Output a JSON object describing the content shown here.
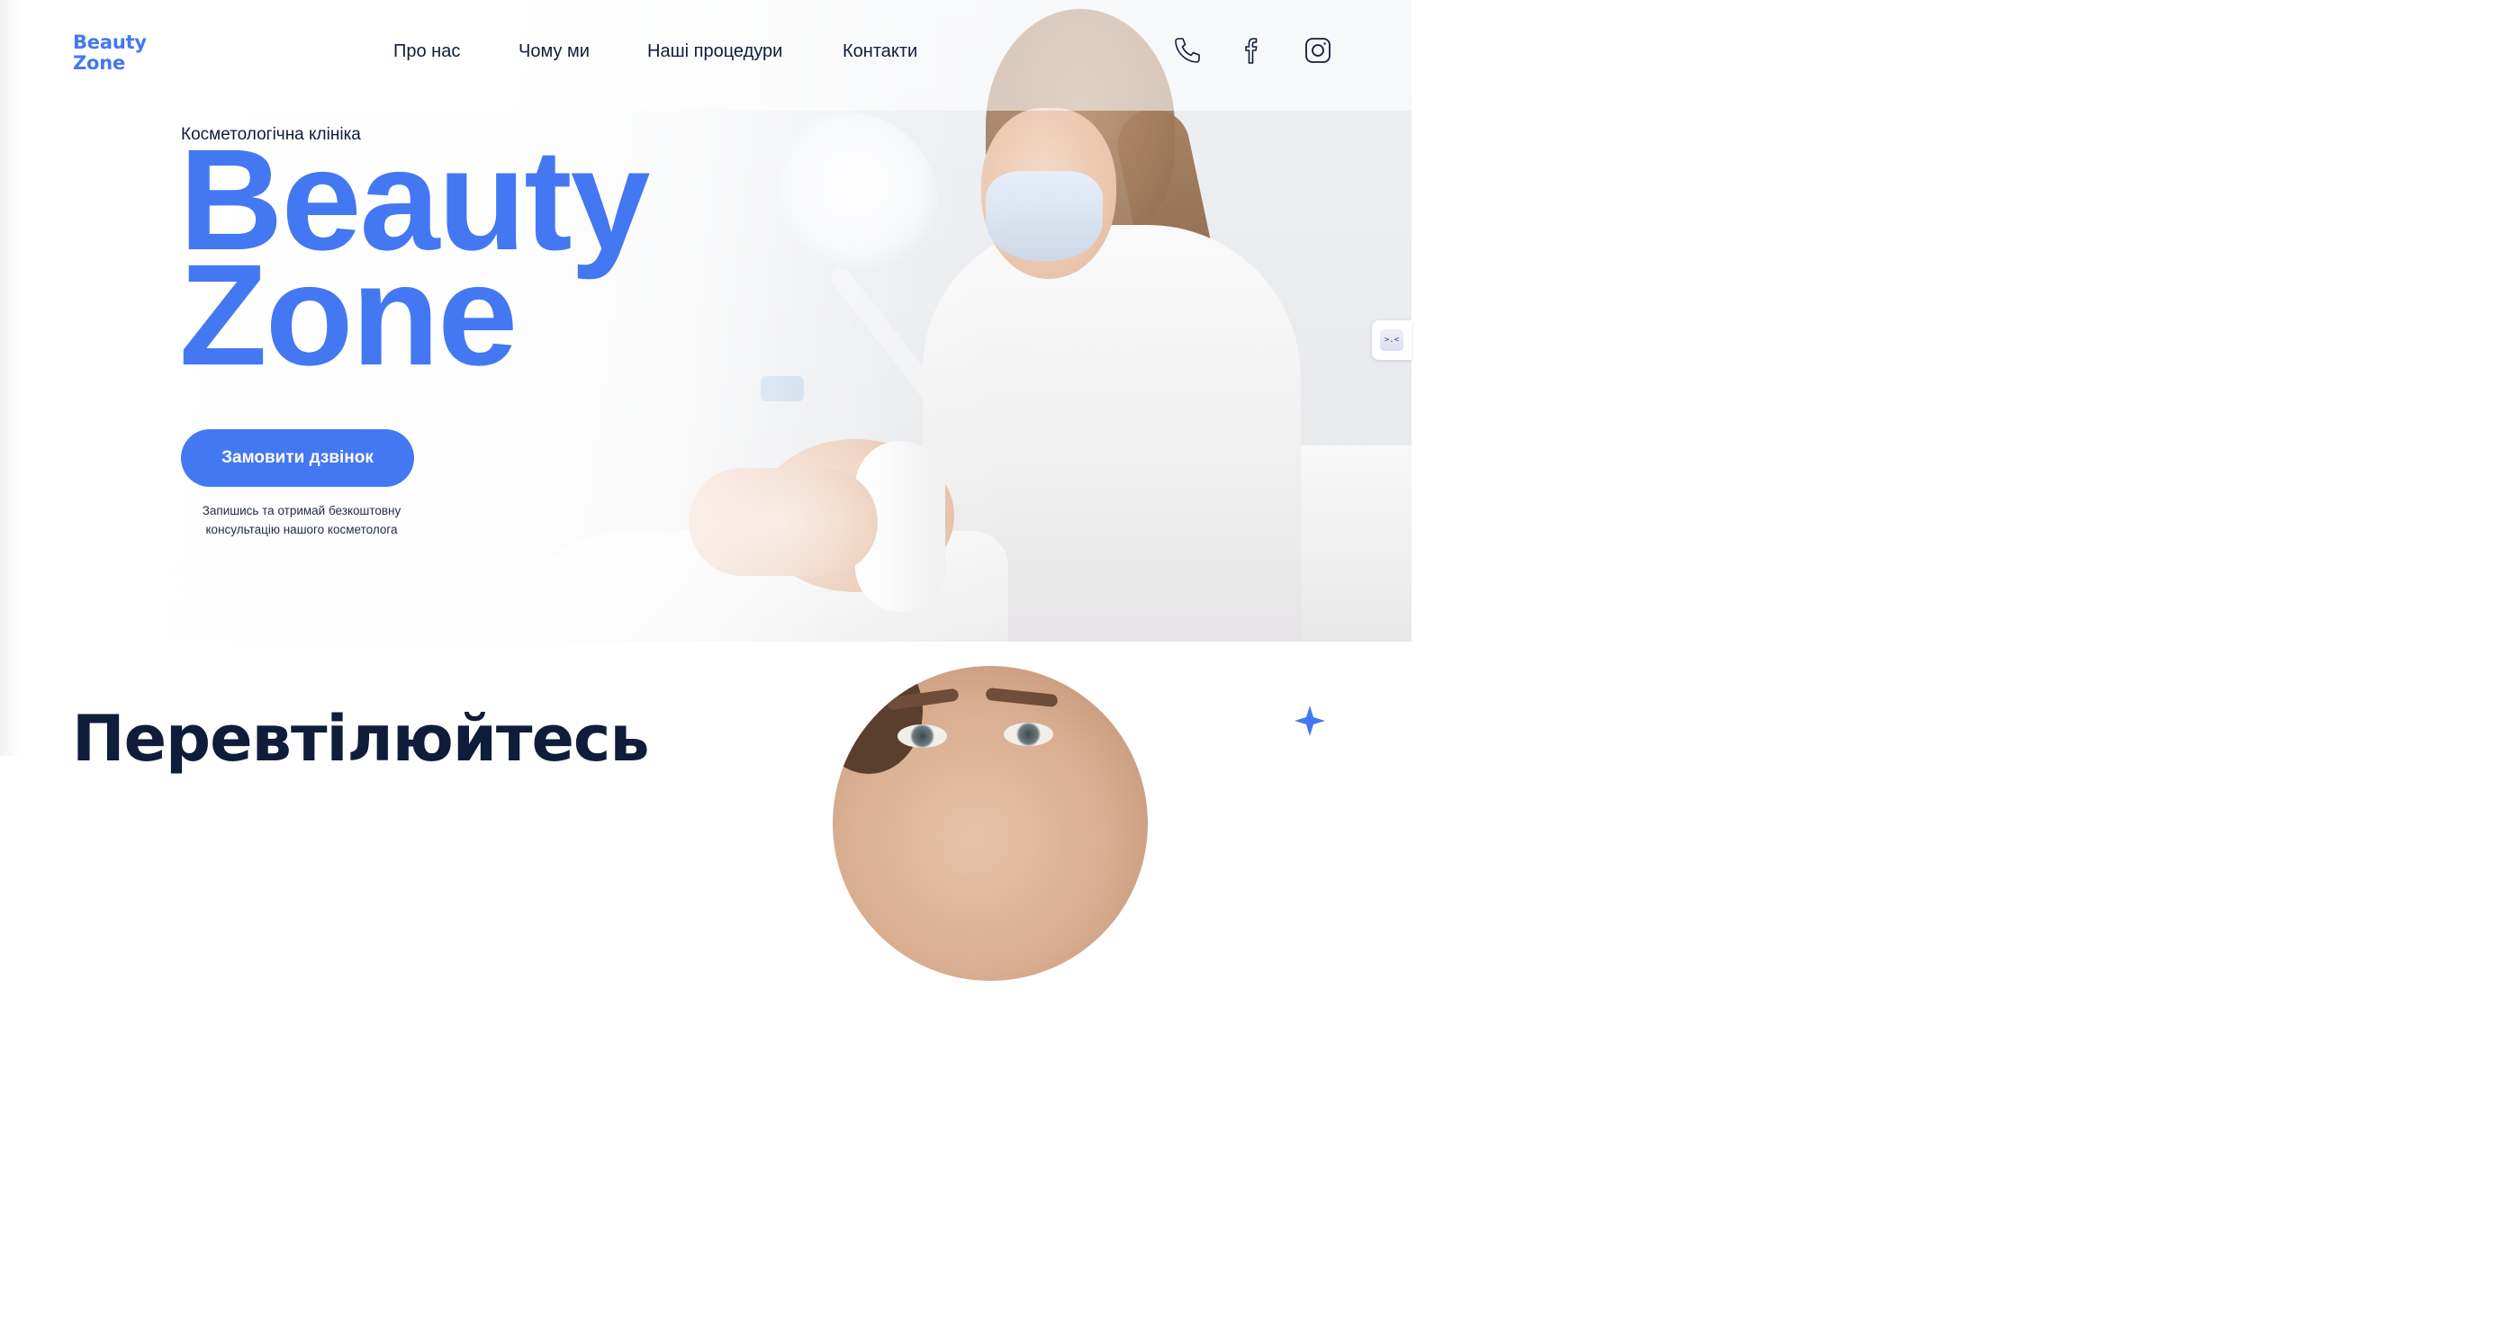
{
  "header": {
    "logo_line1": "Beauty",
    "logo_line2": "Zone",
    "nav": [
      "Про нас",
      "Чому ми",
      "Наші процедури",
      "Контакти"
    ],
    "icons": [
      "phone-icon",
      "facebook-icon",
      "instagram-icon"
    ]
  },
  "hero": {
    "eyebrow": "Косметологічна клініка",
    "title_line1": "Beauty",
    "title_line2": "Zone",
    "cta_label": "Замовити дзвінок",
    "cta_note_line1": "Запишись та отримай безкоштовну",
    "cta_note_line2": "консультацію нашого косметолога"
  },
  "section2": {
    "title": "Перевтілюйтесь"
  },
  "colors": {
    "accent": "#4478f2",
    "text_dark": "#0f1c3a",
    "background": "#ffffff"
  }
}
